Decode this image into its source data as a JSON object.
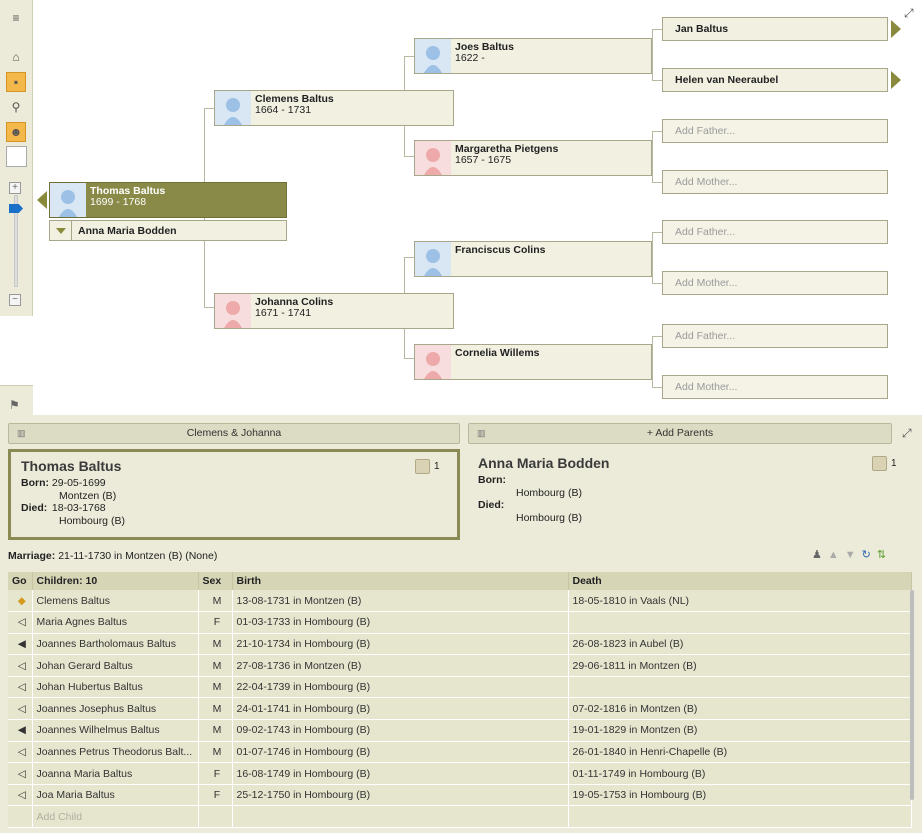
{
  "tree": {
    "root": {
      "name": "Thomas Baltus",
      "dates": "1699 - 1768"
    },
    "spouse": {
      "name": "Anna Maria Bodden"
    },
    "father": {
      "name": "Clemens Baltus",
      "dates": "1664 - 1731"
    },
    "mother": {
      "name": "Johanna Colins",
      "dates": "1671 - 1741"
    },
    "ff": {
      "name": "Joes Baltus",
      "dates": "1622 -"
    },
    "fm": {
      "name": "Margaretha Pietgens",
      "dates": "1657 - 1675"
    },
    "mf": {
      "name": "Franciscus Colins",
      "dates": ""
    },
    "mm": {
      "name": "Cornelia Willems",
      "dates": ""
    },
    "fff": "Jan Baltus",
    "ffm": "Helen van Neeraubel",
    "add_father": "Add Father...",
    "add_mother": "Add Mother..."
  },
  "parents_bar": {
    "left": "Clemens & Johanna",
    "right": "+ Add Parents"
  },
  "person_card": {
    "name": "Thomas Baltus",
    "born_label": "Born:",
    "born_date": "29-05-1699",
    "born_place": "Montzen (B)",
    "died_label": "Died:",
    "died_date": "18-03-1768",
    "died_place": "Hombourg (B)",
    "count": "1"
  },
  "spouse_card": {
    "name": "Anna Maria Bodden",
    "born_label": "Born:",
    "born_place": "Hombourg (B)",
    "died_label": "Died:",
    "died_place": "Hombourg (B)",
    "count": "1"
  },
  "marriage": {
    "label": "Marriage:",
    "text": "21-11-1730 in Montzen (B) (None)"
  },
  "children_table": {
    "headers": [
      "Go",
      "Children: 10",
      "Sex",
      "Birth",
      "Death"
    ],
    "rows": [
      {
        "go": "◆",
        "name": "Clemens Baltus",
        "sex": "M",
        "birth": "13-08-1731 in Montzen (B)",
        "death": "18-05-1810 in Vaals (NL)"
      },
      {
        "go": "◁",
        "name": "Maria Agnes Baltus",
        "sex": "F",
        "birth": "01-03-1733 in Hombourg (B)",
        "death": ""
      },
      {
        "go": "◀",
        "name": "Joannes Bartholomaus Baltus",
        "sex": "M",
        "birth": "21-10-1734 in Hombourg (B)",
        "death": "26-08-1823 in Aubel (B)"
      },
      {
        "go": "◁",
        "name": "Johan Gerard Baltus",
        "sex": "M",
        "birth": "27-08-1736 in Montzen (B)",
        "death": "29-06-1811 in Montzen (B)"
      },
      {
        "go": "◁",
        "name": "Johan Hubertus Baltus",
        "sex": "M",
        "birth": "22-04-1739 in Hombourg (B)",
        "death": ""
      },
      {
        "go": "◁",
        "name": "Joannes Josephus Baltus",
        "sex": "M",
        "birth": "24-01-1741 in Hombourg (B)",
        "death": "07-02-1816 in Montzen (B)"
      },
      {
        "go": "◀",
        "name": "Joannes Wilhelmus Baltus",
        "sex": "M",
        "birth": "09-02-1743 in Hombourg (B)",
        "death": "19-01-1829 in Montzen (B)"
      },
      {
        "go": "◁",
        "name": "Joannes Petrus Theodorus Balt...",
        "sex": "M",
        "birth": "01-07-1746 in Hombourg (B)",
        "death": "26-01-1840 in Henri-Chapelle (B)"
      },
      {
        "go": "◁",
        "name": "Joanna Maria Baltus",
        "sex": "F",
        "birth": "16-08-1749 in Hombourg (B)",
        "death": "01-11-1749 in Hombourg (B)"
      },
      {
        "go": "◁",
        "name": "Joa Maria Baltus",
        "sex": "F",
        "birth": "25-12-1750 in Hombourg (B)",
        "death": "19-05-1753 in Hombourg (B)"
      }
    ],
    "add_child": "Add Child"
  },
  "colors": {
    "root": "#8a8a48",
    "panel": "#ecebd9",
    "male": "#d9e6f3",
    "female": "#f7dddd"
  }
}
